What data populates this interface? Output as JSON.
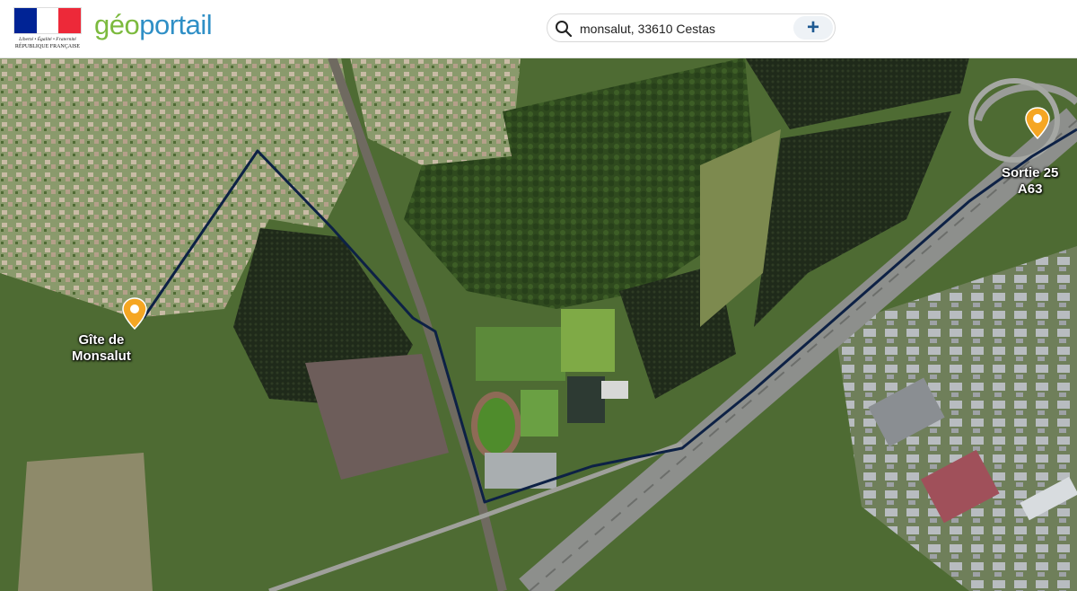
{
  "header": {
    "republic_line1": "Liberté • Égalité • Fraternité",
    "republic_line2": "RÉPUBLIQUE FRANÇAISE",
    "logo_geo": "géo",
    "logo_portail": "portail",
    "flag_colors": [
      "#002395",
      "#ffffff",
      "#ed2939"
    ]
  },
  "search": {
    "value": "monsalut, 33610 Cestas",
    "icon": "search-icon",
    "add_icon": "plus-icon",
    "add_label": "+"
  },
  "map": {
    "view": "satellite",
    "route_color": "#0d2145",
    "marker_color": "#f5a623",
    "markers": [
      {
        "label_line1": "Gîte de",
        "label_line2": "Monsalut"
      },
      {
        "label_line1": "Sortie 25",
        "label_line2": "A63"
      }
    ]
  }
}
